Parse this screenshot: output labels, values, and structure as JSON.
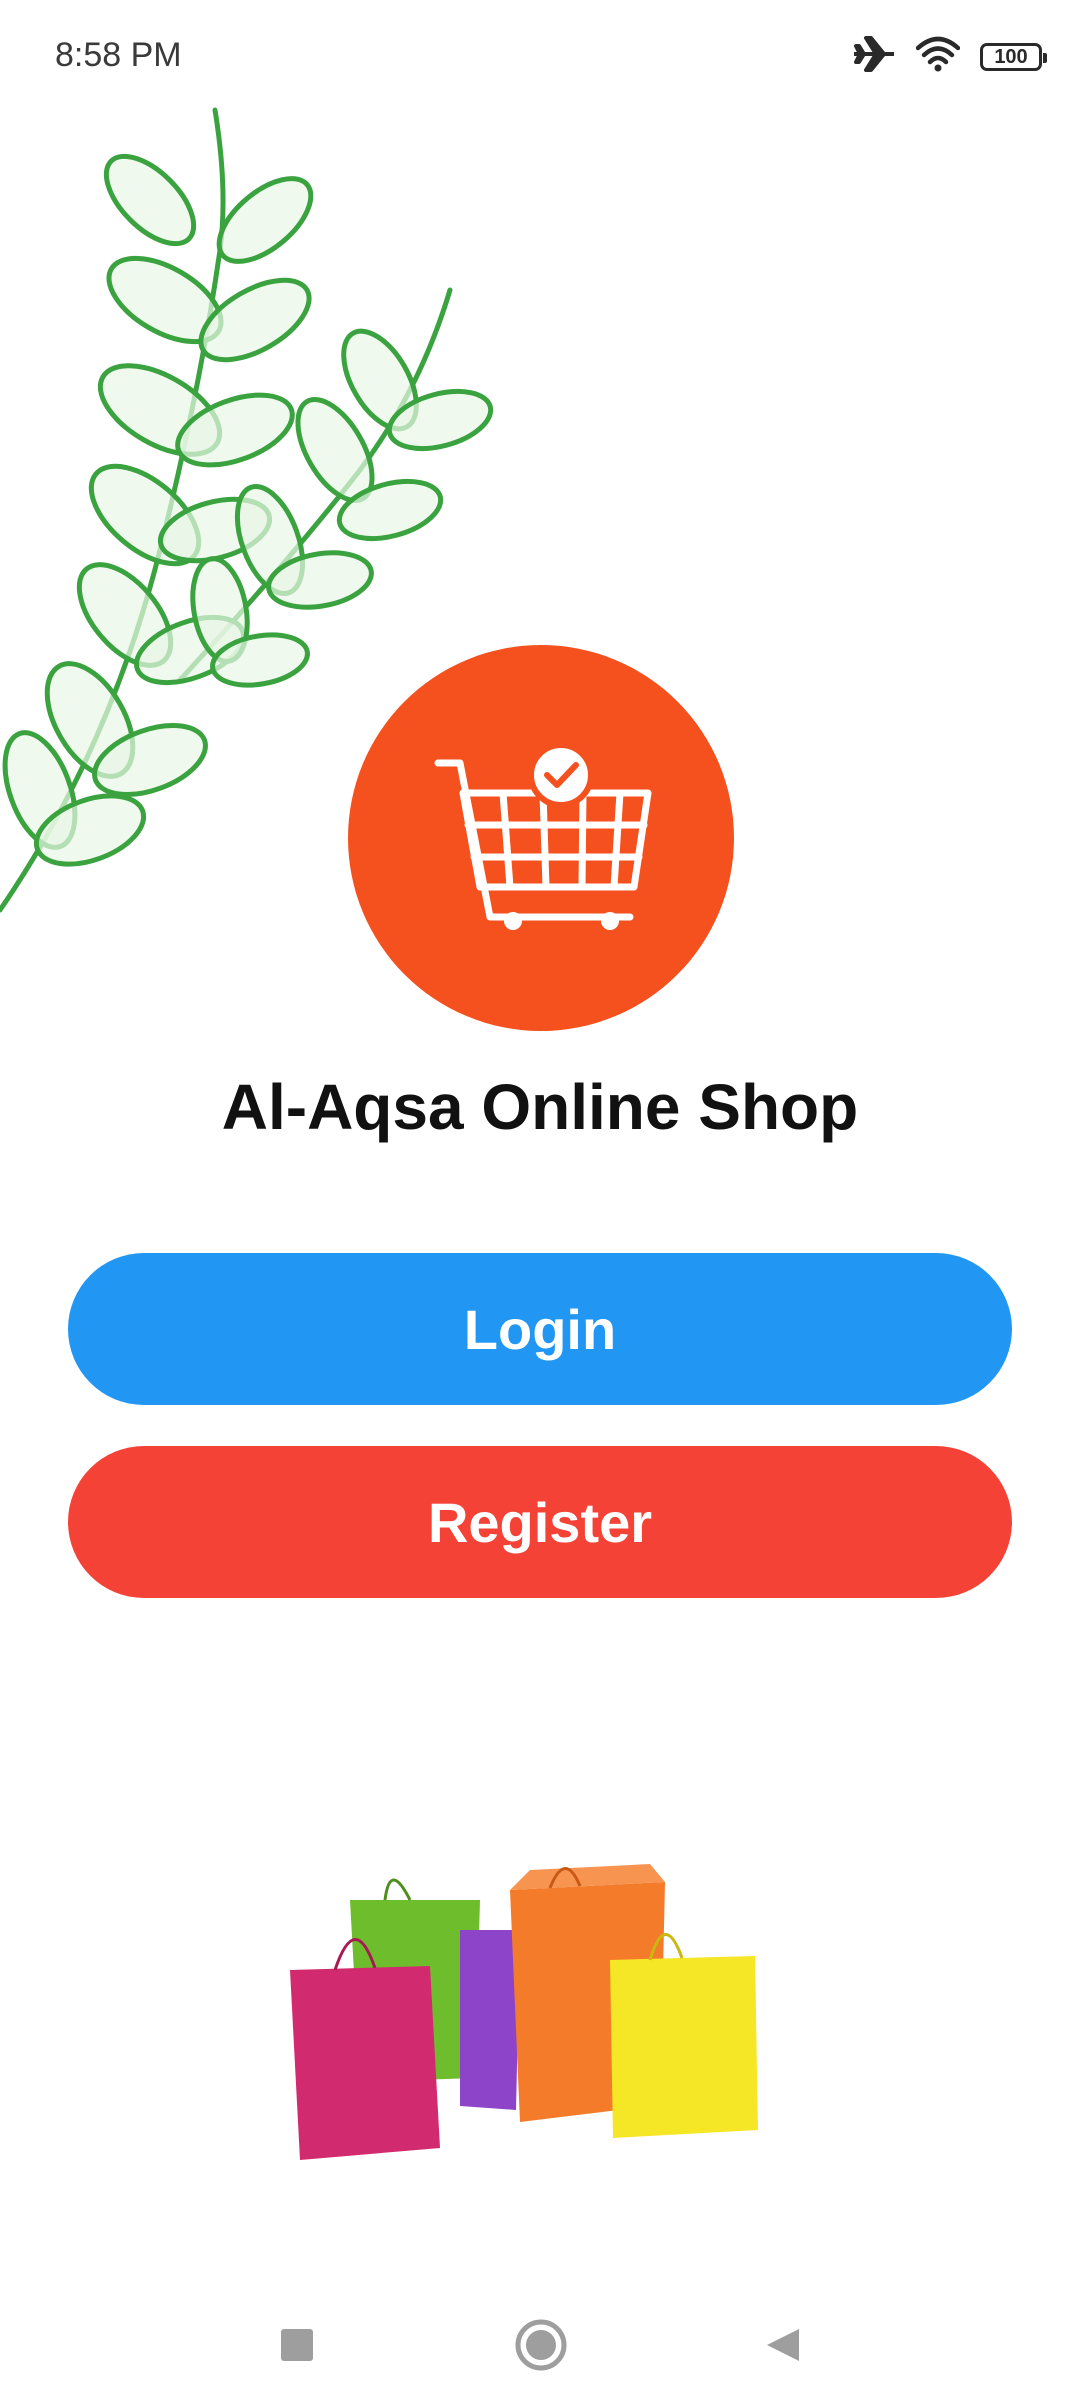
{
  "status_bar": {
    "time": "8:58 PM",
    "battery": "100",
    "icons": [
      "airplane-icon",
      "wifi-icon",
      "battery-icon"
    ]
  },
  "app": {
    "title": "Al-Aqsa Online Shop",
    "logo_icon": "shopping-cart-check-icon",
    "logo_color": "#f4511e"
  },
  "buttons": {
    "login_label": "Login",
    "login_color": "#2196f3",
    "register_label": "Register",
    "register_color": "#f44336"
  },
  "nav_bar": {
    "icons": [
      "recent-apps-icon",
      "home-icon",
      "back-icon"
    ]
  }
}
